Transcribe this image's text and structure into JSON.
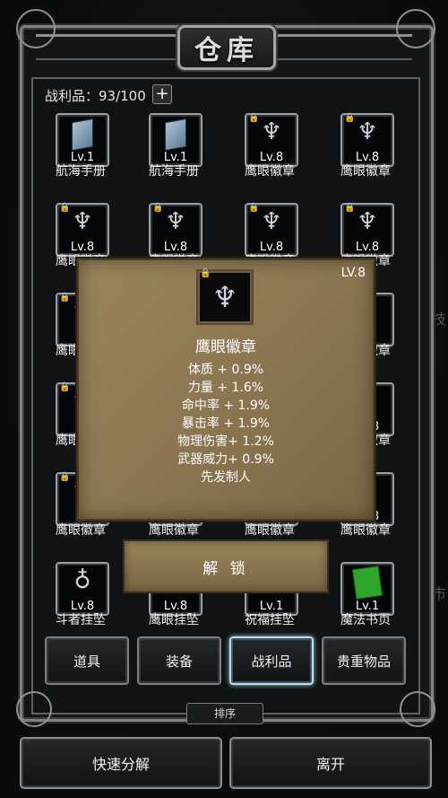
{
  "window": {
    "title": "仓库"
  },
  "loot_count": "战利品：93/100",
  "plus_label": "+",
  "items": [
    {
      "level": "Lv.1",
      "name": "航海手册",
      "icon": "book-icon",
      "locked": false
    },
    {
      "level": "Lv.1",
      "name": "航海手册",
      "icon": "book-icon",
      "locked": false
    },
    {
      "level": "Lv.8",
      "name": "鹰眼徽章",
      "icon": "eagle-badge-icon",
      "locked": true
    },
    {
      "level": "Lv.8",
      "name": "鹰眼徽章",
      "icon": "eagle-badge-icon",
      "locked": true
    },
    {
      "level": "Lv.8",
      "name": "鹰眼徽章",
      "icon": "eagle-badge-icon",
      "locked": true
    },
    {
      "level": "Lv.8",
      "name": "鹰眼徽章",
      "icon": "eagle-badge-icon",
      "locked": true
    },
    {
      "level": "Lv.8",
      "name": "鹰眼徽章",
      "icon": "eagle-badge-icon",
      "locked": true
    },
    {
      "level": "Lv.8",
      "name": "鹰眼徽章",
      "icon": "eagle-badge-icon",
      "locked": true
    },
    {
      "level": "",
      "name": "鹰眼徽章",
      "icon": "eagle-badge-icon",
      "locked": true
    },
    {
      "level": "",
      "name": "鹰眼徽章",
      "icon": "eagle-badge-icon",
      "locked": true
    },
    {
      "level": "",
      "name": "鹰眼徽章",
      "icon": "eagle-badge-icon",
      "locked": true
    },
    {
      "level": "",
      "name": "鹰眼徽章",
      "icon": "eagle-badge-icon",
      "locked": true
    },
    {
      "level": "",
      "name": "鹰眼徽章",
      "icon": "eagle-badge-icon",
      "locked": true
    },
    {
      "level": "Lv.8",
      "name": "鹰眼徽章",
      "icon": "eagle-badge-icon",
      "locked": true
    },
    {
      "level": "",
      "name": "鹰眼徽章",
      "icon": "eagle-badge-icon",
      "locked": true
    },
    {
      "level": "Lv.8",
      "name": "鹰眼徽章",
      "icon": "eagle-badge-icon",
      "locked": true
    },
    {
      "level": "",
      "name": "鹰眼徽章",
      "icon": "eagle-badge-icon",
      "locked": true
    },
    {
      "level": "",
      "name": "鹰眼徽章",
      "icon": "eagle-badge-icon",
      "locked": false
    },
    {
      "level": "",
      "name": "鹰眼徽章",
      "icon": "eagle-badge-icon",
      "locked": false
    },
    {
      "level": "Lv.8",
      "name": "鹰眼徽章",
      "icon": "eagle-badge-icon",
      "locked": true
    },
    {
      "level": "Lv.8",
      "name": "斗者挂坠",
      "icon": "pendant-icon",
      "locked": false
    },
    {
      "level": "Lv.8",
      "name": "鹰眼挂坠",
      "icon": "pendant-icon",
      "locked": false
    },
    {
      "level": "Lv.1",
      "name": "祝福挂坠",
      "icon": "pendant-icon",
      "locked": false
    },
    {
      "level": "Lv.1",
      "name": "魔法书页",
      "icon": "magic-page-icon",
      "locked": false
    }
  ],
  "tooltip": {
    "level": "LV.8",
    "name": "鹰眼徽章",
    "icon": "eagle-badge-icon",
    "stats": [
      "体质 + 0.9%",
      "力量 + 1.6%",
      "命中率 + 1.9%",
      "暴击率 + 1.9%",
      "物理伤害+ 1.2%",
      "武器威力+ 0.9%",
      "先发制人"
    ],
    "unlock_label": "解 锁"
  },
  "tabs": [
    {
      "label": "道具",
      "active": false
    },
    {
      "label": "装备",
      "active": false
    },
    {
      "label": "战利品",
      "active": true
    },
    {
      "label": "贵重物品",
      "active": false
    }
  ],
  "sort_label": "排序",
  "buttons": {
    "decompose": "快速分解",
    "leave": "离开"
  },
  "edge_text": [
    "技",
    "市"
  ],
  "colors": {
    "tooltip_bg": "#8a7550",
    "active_tab_glow": "#8fd0f0",
    "frame": "#7d8287"
  }
}
